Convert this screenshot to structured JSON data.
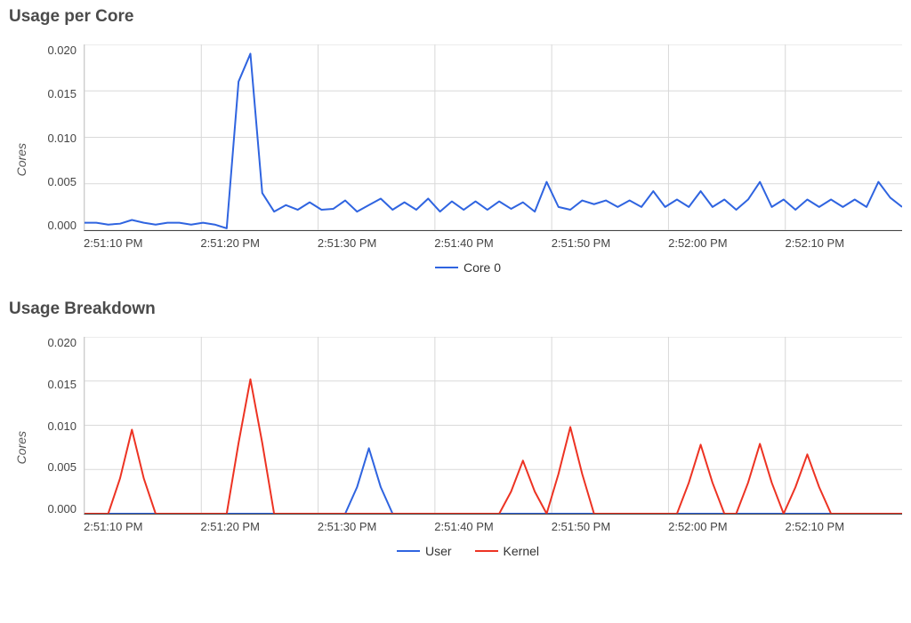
{
  "chart_data": [
    {
      "type": "line",
      "title": "Usage per Core",
      "ylabel": "Cores",
      "xlabel": "",
      "ylim": [
        0.0,
        0.02
      ],
      "y_ticks": [
        "0.020",
        "0.015",
        "0.010",
        "0.005",
        "0.000"
      ],
      "x_ticks": [
        "2:51:10 PM",
        "2:51:20 PM",
        "2:51:30 PM",
        "2:51:40 PM",
        "2:51:50 PM",
        "2:52:00 PM",
        "2:52:10 PM"
      ],
      "series": [
        {
          "name": "Core 0",
          "color": "#2f64e0",
          "x_index": [
            0,
            1,
            2,
            3,
            4,
            5,
            6,
            7,
            8,
            9,
            10,
            11,
            12,
            13,
            14,
            15,
            16,
            17,
            18,
            19,
            20,
            21,
            22,
            23,
            24,
            25,
            26,
            27,
            28,
            29,
            30,
            31,
            32,
            33,
            34,
            35,
            36,
            37,
            38,
            39,
            40,
            41,
            42,
            43,
            44,
            45,
            46,
            47,
            48,
            49,
            50,
            51,
            52,
            53,
            54,
            55,
            56,
            57,
            58,
            59,
            60,
            61,
            62,
            63,
            64,
            65,
            66,
            67,
            68,
            69
          ],
          "values": [
            0.0008,
            0.0008,
            0.0006,
            0.0007,
            0.0011,
            0.0008,
            0.0006,
            0.0008,
            0.0008,
            0.0006,
            0.0008,
            0.0006,
            0.0002,
            0.016,
            0.019,
            0.004,
            0.002,
            0.0027,
            0.0022,
            0.003,
            0.0022,
            0.0023,
            0.0032,
            0.002,
            0.0027,
            0.0034,
            0.0022,
            0.003,
            0.0022,
            0.0034,
            0.002,
            0.0031,
            0.0022,
            0.0031,
            0.0022,
            0.0031,
            0.0023,
            0.003,
            0.002,
            0.0052,
            0.0025,
            0.0022,
            0.0032,
            0.0028,
            0.0032,
            0.0025,
            0.0032,
            0.0025,
            0.0042,
            0.0025,
            0.0033,
            0.0025,
            0.0042,
            0.0025,
            0.0033,
            0.0022,
            0.0033,
            0.0052,
            0.0025,
            0.0033,
            0.0022,
            0.0033,
            0.0025,
            0.0033,
            0.0025,
            0.0033,
            0.0025,
            0.0052,
            0.0035,
            0.0025
          ]
        }
      ],
      "legend": [
        {
          "label": "Core 0",
          "color": "#2f64e0"
        }
      ]
    },
    {
      "type": "line",
      "title": "Usage Breakdown",
      "ylabel": "Cores",
      "xlabel": "",
      "ylim": [
        0.0,
        0.02
      ],
      "y_ticks": [
        "0.020",
        "0.015",
        "0.010",
        "0.005",
        "0.000"
      ],
      "x_ticks": [
        "2:51:10 PM",
        "2:51:20 PM",
        "2:51:30 PM",
        "2:51:40 PM",
        "2:51:50 PM",
        "2:52:00 PM",
        "2:52:10 PM"
      ],
      "series": [
        {
          "name": "User",
          "color": "#2f64e0",
          "x_index": [
            0,
            1,
            2,
            3,
            4,
            5,
            6,
            7,
            8,
            9,
            10,
            11,
            12,
            13,
            14,
            15,
            16,
            17,
            18,
            19,
            20,
            21,
            22,
            23,
            24,
            25,
            26,
            27,
            28,
            29,
            30,
            31,
            32,
            33,
            34,
            35,
            36,
            37,
            38,
            39,
            40,
            41,
            42,
            43,
            44,
            45,
            46,
            47,
            48,
            49,
            50,
            51,
            52,
            53,
            54,
            55,
            56,
            57,
            58,
            59,
            60,
            61,
            62,
            63,
            64,
            65,
            66,
            67,
            68,
            69
          ],
          "values": [
            0,
            0,
            0,
            0,
            0,
            0,
            0,
            0,
            0,
            0,
            0,
            0,
            0,
            0,
            0,
            0,
            0,
            0,
            0,
            0,
            0,
            0,
            0,
            0.003,
            0.0074,
            0.003,
            0,
            0,
            0,
            0,
            0,
            0,
            0,
            0,
            0,
            0,
            0,
            0,
            0,
            0,
            0,
            0,
            0,
            0,
            0,
            0,
            0,
            0,
            0,
            0,
            0,
            0,
            0,
            0,
            0,
            0,
            0,
            0,
            0,
            0,
            0,
            0,
            0,
            0,
            0,
            0,
            0,
            0,
            0,
            0
          ]
        },
        {
          "name": "Kernel",
          "color": "#ed3323",
          "x_index": [
            0,
            1,
            2,
            3,
            4,
            5,
            6,
            7,
            8,
            9,
            10,
            11,
            12,
            13,
            14,
            15,
            16,
            17,
            18,
            19,
            20,
            21,
            22,
            23,
            24,
            25,
            26,
            27,
            28,
            29,
            30,
            31,
            32,
            33,
            34,
            35,
            36,
            37,
            38,
            39,
            40,
            41,
            42,
            43,
            44,
            45,
            46,
            47,
            48,
            49,
            50,
            51,
            52,
            53,
            54,
            55,
            56,
            57,
            58,
            59,
            60,
            61,
            62,
            63,
            64,
            65,
            66,
            67,
            68,
            69
          ],
          "values": [
            0,
            0,
            0,
            0.004,
            0.0095,
            0.004,
            0,
            0,
            0,
            0,
            0,
            0,
            0,
            0.008,
            0.0152,
            0.008,
            0,
            0,
            0,
            0,
            0,
            0,
            0,
            0,
            0,
            0,
            0,
            0,
            0,
            0,
            0,
            0,
            0,
            0,
            0,
            0,
            0.0025,
            0.006,
            0.0025,
            0,
            0.0045,
            0.0098,
            0.0045,
            0,
            0,
            0,
            0,
            0,
            0,
            0,
            0,
            0.0035,
            0.0078,
            0.0035,
            0,
            0,
            0.0035,
            0.0079,
            0.0035,
            0,
            0.003,
            0.0067,
            0.003,
            0,
            0,
            0,
            0,
            0,
            0,
            0
          ]
        }
      ],
      "legend": [
        {
          "label": "User",
          "color": "#2f64e0"
        },
        {
          "label": "Kernel",
          "color": "#ed3323"
        }
      ]
    }
  ]
}
